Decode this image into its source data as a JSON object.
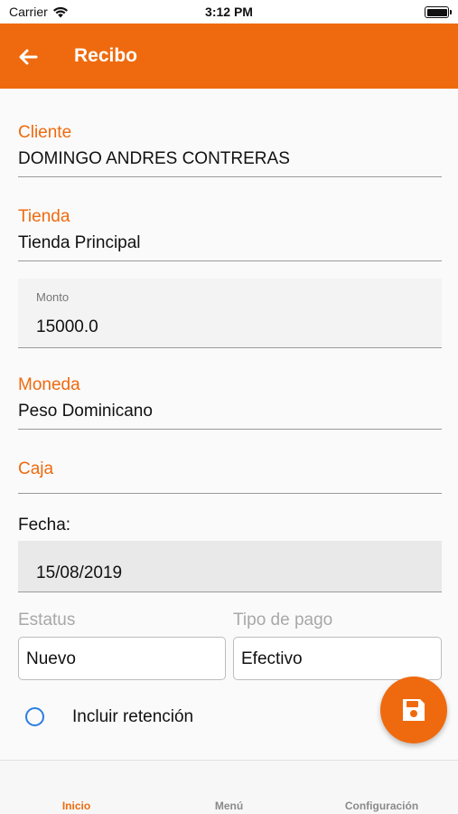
{
  "status_bar": {
    "carrier": "Carrier",
    "time": "3:12 PM"
  },
  "header": {
    "title": "Recibo"
  },
  "form": {
    "cliente": {
      "label": "Cliente",
      "value": "DOMINGO ANDRES CONTRERAS"
    },
    "tienda": {
      "label": "Tienda",
      "value": "Tienda Principal"
    },
    "monto": {
      "label": "Monto",
      "value": "15000.0"
    },
    "moneda": {
      "label": "Moneda",
      "value": "Peso Dominicano"
    },
    "caja": {
      "label": "Caja",
      "value": ""
    },
    "fecha": {
      "label": "Fecha:",
      "value": "15/08/2019"
    },
    "estatus": {
      "label": "Estatus",
      "value": "Nuevo"
    },
    "tipo_pago": {
      "label": "Tipo de pago",
      "value": "Efectivo"
    },
    "retencion": {
      "label": "Incluir retención",
      "checked": false
    }
  },
  "bottom_nav": {
    "items": [
      "Inicio",
      "Menú",
      "Configuración"
    ],
    "active": "Inicio"
  },
  "colors": {
    "accent": "#ef6a0e",
    "radio": "#2a7de1"
  },
  "icons": {
    "back": "arrow-left-icon",
    "save": "floppy-disk-icon",
    "wifi": "wifi-icon",
    "battery": "battery-icon"
  }
}
